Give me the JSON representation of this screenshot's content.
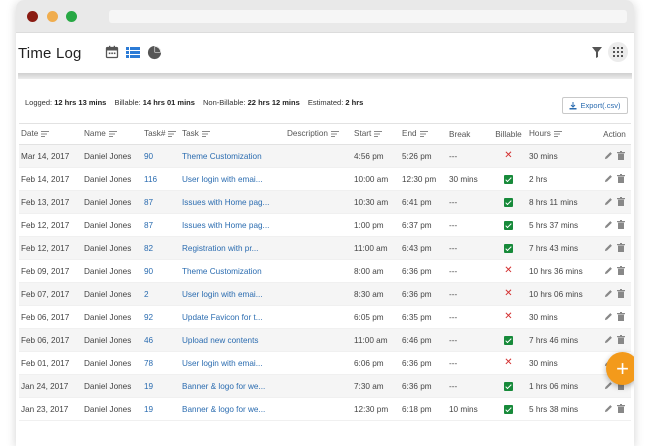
{
  "header": {
    "title": "Time Log"
  },
  "view_icons": [
    "calendar-icon",
    "list-view-icon",
    "pie-chart-icon"
  ],
  "tool_icons": [
    "filter-icon",
    "grid-menu-icon"
  ],
  "summary": {
    "logged_label": "Logged:",
    "logged_value": "12 hrs 13 mins",
    "billable_label": "Billable:",
    "billable_value": "14 hrs 01 mins",
    "nonbillable_label": "Non-Billable:",
    "nonbillable_value": "22 hrs 12 mins",
    "estimated_label": "Estimated:",
    "estimated_value": "2 hrs"
  },
  "export": {
    "label": "Export(.csv)"
  },
  "columns": [
    "Date",
    "Name",
    "Task#",
    "Task",
    "Description",
    "Start",
    "End",
    "Break",
    "Billable",
    "Hours",
    "Action"
  ],
  "colors": {
    "accent": "#2b6cb0",
    "fab": "#f39a1b",
    "billable_yes": "#178a3a",
    "billable_no": "#d32f2f"
  },
  "rows": [
    {
      "date": "Mar 14, 2017",
      "name": "Daniel Jones",
      "task_no": "90",
      "task": "Theme Customization",
      "description": "",
      "start": "4:56 pm",
      "end": "5:26 pm",
      "break": "---",
      "billable": false,
      "hours": "30 mins"
    },
    {
      "date": "Feb 14, 2017",
      "name": "Daniel Jones",
      "task_no": "116",
      "task": "User login with emai...",
      "description": "",
      "start": "10:00 am",
      "end": "12:30 pm",
      "break": "30 mins",
      "billable": true,
      "hours": "2 hrs"
    },
    {
      "date": "Feb 13, 2017",
      "name": "Daniel Jones",
      "task_no": "87",
      "task": "Issues with Home pag...",
      "description": "",
      "start": "10:30 am",
      "end": "6:41 pm",
      "break": "---",
      "billable": true,
      "hours": "8 hrs 11 mins"
    },
    {
      "date": "Feb 12, 2017",
      "name": "Daniel Jones",
      "task_no": "87",
      "task": "Issues with Home pag...",
      "description": "",
      "start": "1:00 pm",
      "end": "6:37 pm",
      "break": "---",
      "billable": true,
      "hours": "5 hrs 37 mins"
    },
    {
      "date": "Feb 12, 2017",
      "name": "Daniel Jones",
      "task_no": "82",
      "task": "Registration with pr...",
      "description": "",
      "start": "11:00 am",
      "end": "6:43 pm",
      "break": "---",
      "billable": true,
      "hours": "7 hrs 43 mins"
    },
    {
      "date": "Feb 09, 2017",
      "name": "Daniel Jones",
      "task_no": "90",
      "task": "Theme Customization",
      "description": "",
      "start": "8:00 am",
      "end": "6:36 pm",
      "break": "---",
      "billable": false,
      "hours": "10 hrs 36 mins"
    },
    {
      "date": "Feb 07, 2017",
      "name": "Daniel Jones",
      "task_no": "2",
      "task": "User login with emai...",
      "description": "",
      "start": "8:30 am",
      "end": "6:36 pm",
      "break": "---",
      "billable": false,
      "hours": "10 hrs 06 mins"
    },
    {
      "date": "Feb 06, 2017",
      "name": "Daniel Jones",
      "task_no": "92",
      "task": "Update Favicon for t...",
      "description": "",
      "start": "6:05 pm",
      "end": "6:35 pm",
      "break": "---",
      "billable": false,
      "hours": "30 mins"
    },
    {
      "date": "Feb 06, 2017",
      "name": "Daniel Jones",
      "task_no": "46",
      "task": "Upload new contents",
      "description": "",
      "start": "11:00 am",
      "end": "6:46 pm",
      "break": "---",
      "billable": true,
      "hours": "7 hrs 46 mins"
    },
    {
      "date": "Feb 01, 2017",
      "name": "Daniel Jones",
      "task_no": "78",
      "task": "User login with emai...",
      "description": "",
      "start": "6:06 pm",
      "end": "6:36 pm",
      "break": "---",
      "billable": false,
      "hours": "30 mins"
    },
    {
      "date": "Jan 24, 2017",
      "name": "Daniel Jones",
      "task_no": "19",
      "task": "Banner & logo for we...",
      "description": "",
      "start": "7:30 am",
      "end": "6:36 pm",
      "break": "---",
      "billable": true,
      "hours": "1 hrs 06 mins"
    },
    {
      "date": "Jan 23, 2017",
      "name": "Daniel Jones",
      "task_no": "19",
      "task": "Banner & logo for we...",
      "description": "",
      "start": "12:30 pm",
      "end": "6:18 pm",
      "break": "10 mins",
      "billable": true,
      "hours": "5 hrs 38 mins"
    }
  ]
}
